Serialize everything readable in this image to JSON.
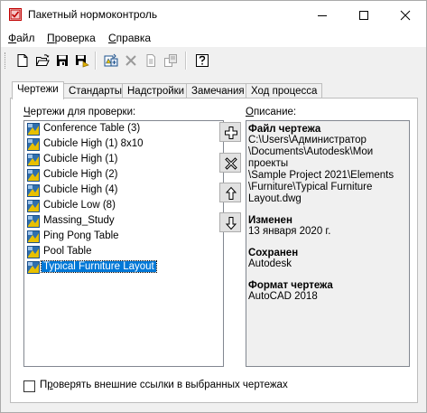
{
  "window": {
    "title": "Пакетный нормоконтроль"
  },
  "menu": [
    {
      "label": "Файл",
      "accel": "Ф",
      "rest": "айл"
    },
    {
      "label": "Проверка",
      "accel": "П",
      "rest": "роверка"
    },
    {
      "label": "Справка",
      "accel": "С",
      "rest": "правка"
    }
  ],
  "toolbar": {
    "icons": [
      "new-icon",
      "open-icon",
      "save-icon",
      "save-as-icon",
      "add-drawing-icon",
      "remove-drawing-icon",
      "copy-icon",
      "batch-icon",
      "help-icon"
    ]
  },
  "tabs": [
    {
      "label": "Чертежи",
      "active": true
    },
    {
      "label": "Стандарты"
    },
    {
      "label": "Надстройки"
    },
    {
      "label": "Замечания"
    },
    {
      "label": "Ход процесса"
    }
  ],
  "drawings_panel": {
    "label_accel": "Ч",
    "label_rest": "ертежи для проверки:",
    "items": [
      "Conference Table (3)",
      "Cubicle High (1) 8x10",
      "Cubicle High (1)",
      "Cubicle High (2)",
      "Cubicle High (4)",
      "Cubicle Low (8)",
      "Massing_Study",
      "Ping Pong Table",
      "Pool Table",
      "Typical Furniture Layout"
    ],
    "selected_index": 9
  },
  "description": {
    "label_accel": "О",
    "label_rest": "писание:",
    "file_heading": "Файл чертежа",
    "file_lines": [
      "C:\\Users\\Администратор",
      "\\Documents\\Autodesk\\Мои проекты",
      "\\Sample Project 2021\\Elements",
      "\\Furniture\\Typical Furniture",
      "Layout.dwg"
    ],
    "modified_heading": "Изменен",
    "modified_value": "13 января 2020 г.",
    "saved_heading": "Сохранен",
    "saved_value": "Autodesk",
    "format_heading": "Формат чертежа",
    "format_value": "AutoCAD 2018"
  },
  "xref_checkbox": {
    "accel": "р",
    "pre": "П",
    "rest": "оверять внешние ссылки в выбранных чертежах",
    "checked": false
  }
}
